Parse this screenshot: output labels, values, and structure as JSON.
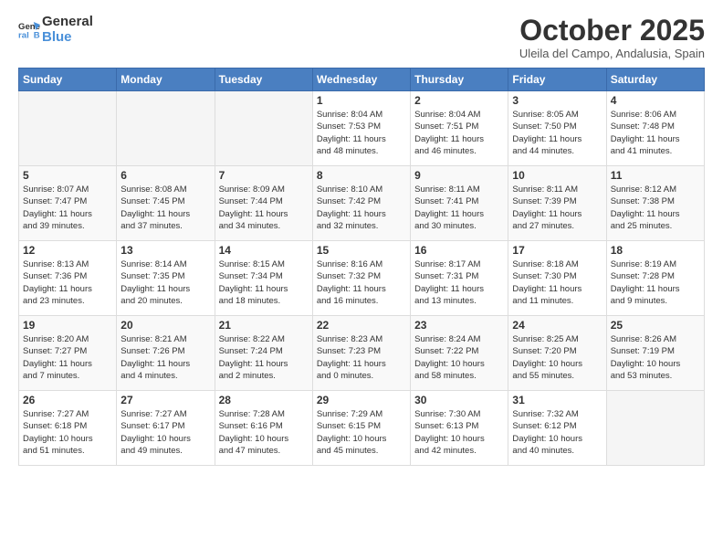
{
  "logo": {
    "line1": "General",
    "line2": "Blue"
  },
  "title": "October 2025",
  "subtitle": "Uleila del Campo, Andalusia, Spain",
  "days_header": [
    "Sunday",
    "Monday",
    "Tuesday",
    "Wednesday",
    "Thursday",
    "Friday",
    "Saturday"
  ],
  "weeks": [
    [
      {
        "day": "",
        "info": ""
      },
      {
        "day": "",
        "info": ""
      },
      {
        "day": "",
        "info": ""
      },
      {
        "day": "1",
        "info": "Sunrise: 8:04 AM\nSunset: 7:53 PM\nDaylight: 11 hours\nand 48 minutes."
      },
      {
        "day": "2",
        "info": "Sunrise: 8:04 AM\nSunset: 7:51 PM\nDaylight: 11 hours\nand 46 minutes."
      },
      {
        "day": "3",
        "info": "Sunrise: 8:05 AM\nSunset: 7:50 PM\nDaylight: 11 hours\nand 44 minutes."
      },
      {
        "day": "4",
        "info": "Sunrise: 8:06 AM\nSunset: 7:48 PM\nDaylight: 11 hours\nand 41 minutes."
      }
    ],
    [
      {
        "day": "5",
        "info": "Sunrise: 8:07 AM\nSunset: 7:47 PM\nDaylight: 11 hours\nand 39 minutes."
      },
      {
        "day": "6",
        "info": "Sunrise: 8:08 AM\nSunset: 7:45 PM\nDaylight: 11 hours\nand 37 minutes."
      },
      {
        "day": "7",
        "info": "Sunrise: 8:09 AM\nSunset: 7:44 PM\nDaylight: 11 hours\nand 34 minutes."
      },
      {
        "day": "8",
        "info": "Sunrise: 8:10 AM\nSunset: 7:42 PM\nDaylight: 11 hours\nand 32 minutes."
      },
      {
        "day": "9",
        "info": "Sunrise: 8:11 AM\nSunset: 7:41 PM\nDaylight: 11 hours\nand 30 minutes."
      },
      {
        "day": "10",
        "info": "Sunrise: 8:11 AM\nSunset: 7:39 PM\nDaylight: 11 hours\nand 27 minutes."
      },
      {
        "day": "11",
        "info": "Sunrise: 8:12 AM\nSunset: 7:38 PM\nDaylight: 11 hours\nand 25 minutes."
      }
    ],
    [
      {
        "day": "12",
        "info": "Sunrise: 8:13 AM\nSunset: 7:36 PM\nDaylight: 11 hours\nand 23 minutes."
      },
      {
        "day": "13",
        "info": "Sunrise: 8:14 AM\nSunset: 7:35 PM\nDaylight: 11 hours\nand 20 minutes."
      },
      {
        "day": "14",
        "info": "Sunrise: 8:15 AM\nSunset: 7:34 PM\nDaylight: 11 hours\nand 18 minutes."
      },
      {
        "day": "15",
        "info": "Sunrise: 8:16 AM\nSunset: 7:32 PM\nDaylight: 11 hours\nand 16 minutes."
      },
      {
        "day": "16",
        "info": "Sunrise: 8:17 AM\nSunset: 7:31 PM\nDaylight: 11 hours\nand 13 minutes."
      },
      {
        "day": "17",
        "info": "Sunrise: 8:18 AM\nSunset: 7:30 PM\nDaylight: 11 hours\nand 11 minutes."
      },
      {
        "day": "18",
        "info": "Sunrise: 8:19 AM\nSunset: 7:28 PM\nDaylight: 11 hours\nand 9 minutes."
      }
    ],
    [
      {
        "day": "19",
        "info": "Sunrise: 8:20 AM\nSunset: 7:27 PM\nDaylight: 11 hours\nand 7 minutes."
      },
      {
        "day": "20",
        "info": "Sunrise: 8:21 AM\nSunset: 7:26 PM\nDaylight: 11 hours\nand 4 minutes."
      },
      {
        "day": "21",
        "info": "Sunrise: 8:22 AM\nSunset: 7:24 PM\nDaylight: 11 hours\nand 2 minutes."
      },
      {
        "day": "22",
        "info": "Sunrise: 8:23 AM\nSunset: 7:23 PM\nDaylight: 11 hours\nand 0 minutes."
      },
      {
        "day": "23",
        "info": "Sunrise: 8:24 AM\nSunset: 7:22 PM\nDaylight: 10 hours\nand 58 minutes."
      },
      {
        "day": "24",
        "info": "Sunrise: 8:25 AM\nSunset: 7:20 PM\nDaylight: 10 hours\nand 55 minutes."
      },
      {
        "day": "25",
        "info": "Sunrise: 8:26 AM\nSunset: 7:19 PM\nDaylight: 10 hours\nand 53 minutes."
      }
    ],
    [
      {
        "day": "26",
        "info": "Sunrise: 7:27 AM\nSunset: 6:18 PM\nDaylight: 10 hours\nand 51 minutes."
      },
      {
        "day": "27",
        "info": "Sunrise: 7:27 AM\nSunset: 6:17 PM\nDaylight: 10 hours\nand 49 minutes."
      },
      {
        "day": "28",
        "info": "Sunrise: 7:28 AM\nSunset: 6:16 PM\nDaylight: 10 hours\nand 47 minutes."
      },
      {
        "day": "29",
        "info": "Sunrise: 7:29 AM\nSunset: 6:15 PM\nDaylight: 10 hours\nand 45 minutes."
      },
      {
        "day": "30",
        "info": "Sunrise: 7:30 AM\nSunset: 6:13 PM\nDaylight: 10 hours\nand 42 minutes."
      },
      {
        "day": "31",
        "info": "Sunrise: 7:32 AM\nSunset: 6:12 PM\nDaylight: 10 hours\nand 40 minutes."
      },
      {
        "day": "",
        "info": ""
      }
    ]
  ]
}
